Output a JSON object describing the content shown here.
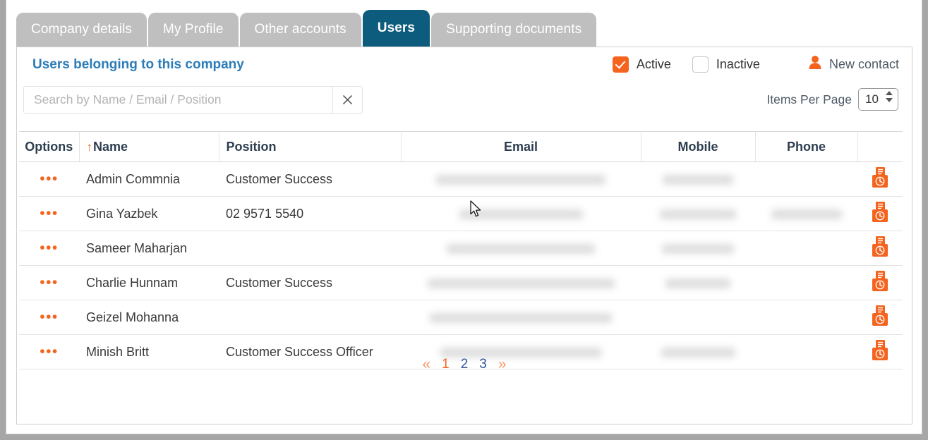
{
  "tabs": [
    {
      "label": "Company details",
      "active": false
    },
    {
      "label": "My Profile",
      "active": false
    },
    {
      "label": "Other accounts",
      "active": false
    },
    {
      "label": "Users",
      "active": true
    },
    {
      "label": "Supporting documents",
      "active": false
    }
  ],
  "panel": {
    "title": "Users belonging to this company",
    "filters": [
      {
        "label": "Active",
        "checked": true
      },
      {
        "label": "Inactive",
        "checked": false
      }
    ],
    "new_contact": {
      "label": "New contact",
      "icon": "person-icon"
    }
  },
  "search": {
    "placeholder": "Search by Name / Email / Position",
    "value": "",
    "clear_icon": "close-icon"
  },
  "items_per_page": {
    "label": "Items Per Page",
    "value": "10"
  },
  "table": {
    "columns": [
      {
        "key": "options",
        "label": "Options"
      },
      {
        "key": "name",
        "label": "Name",
        "sorted": "asc",
        "sort_icon": "arrow-up-icon"
      },
      {
        "key": "position",
        "label": "Position"
      },
      {
        "key": "email",
        "label": "Email"
      },
      {
        "key": "mobile",
        "label": "Mobile"
      },
      {
        "key": "phone",
        "label": "Phone"
      },
      {
        "key": "actions",
        "label": ""
      }
    ],
    "rows": [
      {
        "options": "•••",
        "name": "Admin Commnia",
        "position": "Customer Success",
        "email": "",
        "mobile": "",
        "phone": "",
        "email_redacted_width": 240,
        "mobile_redacted_width": 100,
        "phone_redacted_width": 0,
        "action_icon": "document-clock-icon"
      },
      {
        "options": "•••",
        "name": "Gina Yazbek",
        "position": "02 9571 5540",
        "email": "",
        "mobile": "",
        "phone": "",
        "email_redacted_width": 175,
        "mobile_redacted_width": 108,
        "phone_redacted_width": 100,
        "action_icon": "document-clock-icon"
      },
      {
        "options": "•••",
        "name": "Sameer Maharjan",
        "position": "",
        "email": "",
        "mobile": "",
        "phone": "",
        "email_redacted_width": 210,
        "mobile_redacted_width": 102,
        "phone_redacted_width": 0,
        "action_icon": "document-clock-icon"
      },
      {
        "options": "•••",
        "name": "Charlie Hunnam",
        "position": "Customer Success",
        "email": "",
        "mobile": "",
        "phone": "",
        "email_redacted_width": 265,
        "mobile_redacted_width": 92,
        "phone_redacted_width": 0,
        "action_icon": "document-clock-icon"
      },
      {
        "options": "•••",
        "name": "Geizel Mohanna",
        "position": "",
        "email": "",
        "mobile": "",
        "phone": "",
        "email_redacted_width": 258,
        "mobile_redacted_width": 0,
        "phone_redacted_width": 0,
        "action_icon": "document-clock-icon"
      },
      {
        "options": "•••",
        "name": "Minish Britt",
        "position": "Customer Success Officer",
        "email": "",
        "mobile": "",
        "phone": "",
        "email_redacted_width": 228,
        "mobile_redacted_width": 105,
        "phone_redacted_width": 0,
        "action_icon": "document-clock-icon"
      }
    ]
  },
  "pagination": {
    "first_label": "«",
    "last_label": "»",
    "pages": [
      "1",
      "2",
      "3"
    ],
    "current": "1"
  },
  "colors": {
    "accent_orange": "#f4641e",
    "tab_active": "#0d5b7d",
    "tab_inactive": "#bfbfbf",
    "title_blue": "#2b7cb8",
    "page_link_blue": "#33589e"
  }
}
